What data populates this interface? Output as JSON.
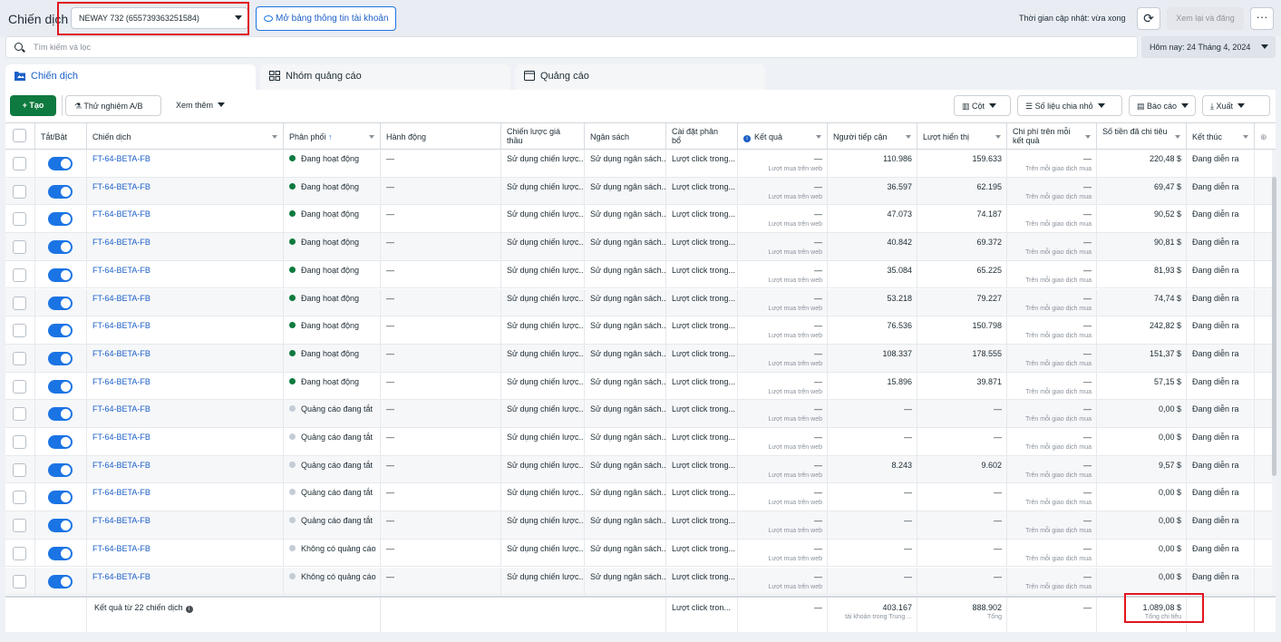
{
  "header": {
    "title": "Chiến dịch",
    "account": "NEWAY 732 (655739363251584)",
    "open_account_label": "Mở bảng thông tin tài khoản",
    "updated": "Thời gian cập nhật: vừa xong",
    "review_label": "Xem lại và đăng",
    "more": "···"
  },
  "search": {
    "placeholder": "Tìm kiếm và lọc"
  },
  "date": {
    "label": "Hôm nay: 24 Tháng 4, 2024"
  },
  "tabs": [
    {
      "label": "Chiến dịch"
    },
    {
      "label": "Nhóm quảng cáo"
    },
    {
      "label": "Quảng cáo"
    }
  ],
  "toolbar": {
    "create": "Tạo",
    "ab_test": "Thử nghiệm A/B",
    "more": "Xem thêm",
    "columns": "Cột",
    "breakdown": "Số liệu chia nhỏ",
    "reports": "Báo cáo",
    "export": "Xuất"
  },
  "columns": [
    "Tắt/Bật",
    "Chiến dịch",
    "Phân phối",
    "Hành động",
    "Chiến lược giá thầu",
    "Ngân sách",
    "Cài đặt phân bổ",
    "Kết quả",
    "Người tiếp cận",
    "Lượt hiển thị",
    "Chi phí trên mỗi kết quả",
    "Số tiền đã chi tiêu",
    "Kết thúc"
  ],
  "cell_defaults": {
    "bid": "Sử dụng chiến lược...",
    "budget": "Sử dụng ngân sách...",
    "attribution": "Lượt click trong...",
    "result": "—",
    "result_sub": "Lượt mua trên web",
    "cost_sub": "Trên mỗi giao dịch mua",
    "end": "Đang diễn ra",
    "action": "—"
  },
  "rows": [
    {
      "name": "FT-64-BETA-FB",
      "status": "Đang hoạt động",
      "active": true,
      "reach": "110.986",
      "impr": "159.633",
      "cost": "—",
      "spent": "220,48 $"
    },
    {
      "name": "FT-64-BETA-FB",
      "status": "Đang hoạt động",
      "active": true,
      "reach": "36.597",
      "impr": "62.195",
      "cost": "—",
      "spent": "69,47 $"
    },
    {
      "name": "FT-64-BETA-FB",
      "status": "Đang hoạt động",
      "active": true,
      "reach": "47.073",
      "impr": "74.187",
      "cost": "—",
      "spent": "90,52 $"
    },
    {
      "name": "FT-64-BETA-FB",
      "status": "Đang hoạt động",
      "active": true,
      "reach": "40.842",
      "impr": "69.372",
      "cost": "—",
      "spent": "90,81 $"
    },
    {
      "name": "FT-64-BETA-FB",
      "status": "Đang hoạt động",
      "active": true,
      "reach": "35.084",
      "impr": "65.225",
      "cost": "—",
      "spent": "81,93 $"
    },
    {
      "name": "FT-64-BETA-FB",
      "status": "Đang hoạt động",
      "active": true,
      "reach": "53.218",
      "impr": "79.227",
      "cost": "—",
      "spent": "74,74 $"
    },
    {
      "name": "FT-64-BETA-FB",
      "status": "Đang hoạt động",
      "active": true,
      "reach": "76.536",
      "impr": "150.798",
      "cost": "—",
      "spent": "242,82 $"
    },
    {
      "name": "FT-64-BETA-FB",
      "status": "Đang hoạt động",
      "active": true,
      "reach": "108.337",
      "impr": "178.555",
      "cost": "—",
      "spent": "151,37 $"
    },
    {
      "name": "FT-64-BETA-FB",
      "status": "Đang hoạt động",
      "active": true,
      "reach": "15.896",
      "impr": "39.871",
      "cost": "—",
      "spent": "57,15 $"
    },
    {
      "name": "FT-64-BETA-FB",
      "status": "Quảng cáo đang tắt",
      "active": false,
      "reach": "—",
      "impr": "—",
      "cost": "—",
      "spent": "0,00 $"
    },
    {
      "name": "FT-64-BETA-FB",
      "status": "Quảng cáo đang tắt",
      "active": false,
      "reach": "—",
      "impr": "—",
      "cost": "—",
      "spent": "0,00 $"
    },
    {
      "name": "FT-64-BETA-FB",
      "status": "Quảng cáo đang tắt",
      "active": false,
      "reach": "8.243",
      "impr": "9.602",
      "cost": "—",
      "spent": "9,57 $"
    },
    {
      "name": "FT-64-BETA-FB",
      "status": "Quảng cáo đang tắt",
      "active": false,
      "reach": "—",
      "impr": "—",
      "cost": "—",
      "spent": "0,00 $"
    },
    {
      "name": "FT-64-BETA-FB",
      "status": "Quảng cáo đang tắt",
      "active": false,
      "reach": "—",
      "impr": "—",
      "cost": "—",
      "spent": "0,00 $"
    },
    {
      "name": "FT-64-BETA-FB",
      "status": "Không có quảng cáo",
      "active": false,
      "reach": "—",
      "impr": "—",
      "cost": "—",
      "spent": "0,00 $"
    },
    {
      "name": "FT-64-BETA-FB",
      "status": "Không có quảng cáo",
      "active": false,
      "reach": "—",
      "impr": "—",
      "cost": "—",
      "spent": "0,00 $"
    }
  ],
  "footer": {
    "label": "Kết quả từ 22 chiến dịch",
    "attribution": "Lượt click tron...",
    "result": "—",
    "reach": "403.167",
    "reach_sub": "tài khoản trong Trung ...",
    "impr": "888.902",
    "impr_sub": "Tổng",
    "cost": "—",
    "spent": "1.089,08 $",
    "spent_sub": "Tổng chi tiêu"
  },
  "colors": {
    "accent": "#1b74e4",
    "active_dot": "#0f7a3f",
    "inactive_dot": "#c4ccd6",
    "highlight": "#e0161d"
  }
}
